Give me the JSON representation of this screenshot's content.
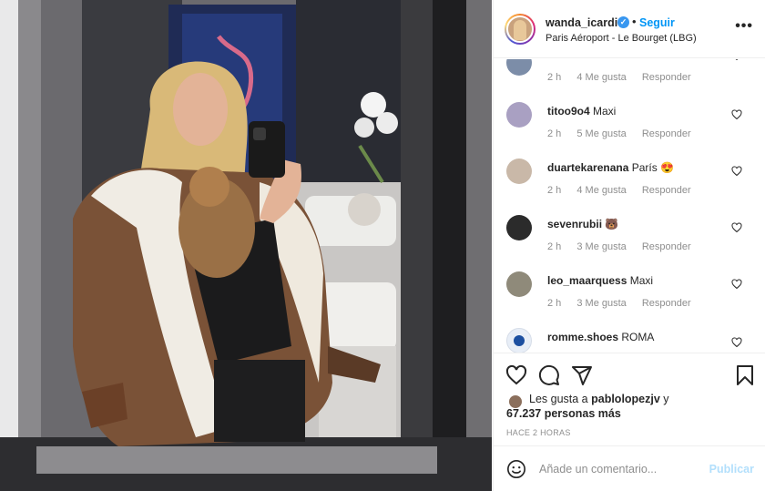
{
  "header": {
    "username": "wanda_icardi",
    "verified_mark": "✓",
    "separator": "•",
    "follow_label": "Seguir",
    "location": "Paris Aéroport - Le Bourget (LBG)",
    "more_icon": "more-options-icon"
  },
  "comments": [
    {
      "user": "",
      "text": "",
      "time": "2 h",
      "likes": "4 Me gusta",
      "reply": "Responder"
    },
    {
      "user": "titoo9o4",
      "text": "Maxi",
      "time": "2 h",
      "likes": "5 Me gusta",
      "reply": "Responder"
    },
    {
      "user": "duartekarenana",
      "text": "París 😍",
      "time": "2 h",
      "likes": "4 Me gusta",
      "reply": "Responder"
    },
    {
      "user": "sevenrubii",
      "text": "🐻",
      "time": "2 h",
      "likes": "3 Me gusta",
      "reply": "Responder"
    },
    {
      "user": "leo_maarquess",
      "text": "Maxi",
      "time": "2 h",
      "likes": "3 Me gusta",
      "reply": "Responder"
    },
    {
      "user": "romme.shoes",
      "text": "ROMA",
      "time": "",
      "likes": "",
      "reply": ""
    }
  ],
  "likes": {
    "prefix": "Les gusta a ",
    "first_user": "pablolopezjv",
    "suffix": " y",
    "count": "67.237 personas más"
  },
  "time_ago": "HACE 2 HORAS",
  "add_comment": {
    "placeholder": "Añade un comentario...",
    "publish_label": "Publicar"
  },
  "colors": {
    "accent": "#0095f6",
    "publish_disabled": "#b2dffc",
    "muted": "#8e8e8e",
    "text": "#262626"
  },
  "icons": [
    "heart-icon",
    "comment-icon",
    "share-icon",
    "bookmark-icon",
    "emoji-icon",
    "verified-icon"
  ]
}
